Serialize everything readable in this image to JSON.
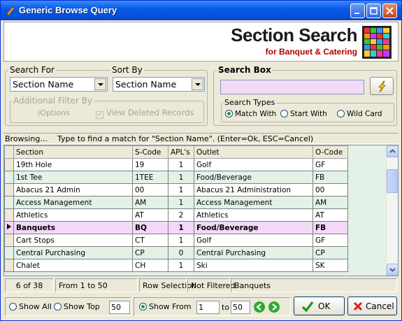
{
  "window": {
    "title": "Generic Browse Query"
  },
  "header": {
    "title": "Section Search",
    "subtitle": "for Banquet & Catering"
  },
  "search_for": {
    "legend": "Search For",
    "value": "Section Name"
  },
  "sort_by": {
    "legend": "Sort By",
    "value": "Section Name"
  },
  "filter": {
    "legend": "Additional Filter By",
    "options_label": "Options",
    "view_deleted_label": "View Deleted Records"
  },
  "search_box": {
    "legend": "Search Box",
    "value": ""
  },
  "search_types": {
    "legend": "Search Types",
    "match_with": "Match With",
    "start_with": "Start With",
    "wild_card": "Wild Card",
    "selected": "Match With"
  },
  "status": {
    "mode": "Browsing...",
    "hint": "Type to find a match for \"Section Name\". (Enter=Ok, ESC=Cancel)"
  },
  "grid": {
    "columns": [
      "Section",
      "S-Code",
      "APL's",
      "Outlet",
      "O-Code"
    ],
    "rows": [
      [
        "19th Hole",
        "19",
        "1",
        "Golf",
        "GF"
      ],
      [
        "1st Tee",
        "1TEE",
        "1",
        "Food/Beverage",
        "FB"
      ],
      [
        "Abacus 21 Admin",
        "00",
        "1",
        "Abacus 21 Administration",
        "00"
      ],
      [
        "Access Management",
        "AM",
        "1",
        "Access Management",
        "AM"
      ],
      [
        "Athletics",
        "AT",
        "2",
        "Athletics",
        "AT"
      ],
      [
        "Banquets",
        "BQ",
        "1",
        "Food/Beverage",
        "FB"
      ],
      [
        "Cart Stops",
        "CT",
        "1",
        "Golf",
        "GF"
      ],
      [
        "Central Purchasing",
        "CP",
        "0",
        "Central Purchasing",
        "CP"
      ],
      [
        "Chalet",
        "CH",
        "1",
        "Ski",
        "SK"
      ]
    ],
    "selected_index": 5
  },
  "info": {
    "count": "6 of 38",
    "range": "From 1 to 50",
    "selection": "Row Selection",
    "filter": "Not Filtered",
    "current": "Banquets"
  },
  "bottom": {
    "show_all": "Show All",
    "show_top": "Show Top",
    "show_top_value": "50",
    "show_from": "Show From",
    "from_value": "1",
    "to_label": "to",
    "to_value": "50",
    "ok_label": "OK",
    "cancel_label": "Cancel"
  },
  "colors": {
    "selected_row": "#f3d8f8",
    "alt_row": "#e3f1e7",
    "title_bar": "#0a5ae8",
    "brand_red": "#b00000"
  }
}
